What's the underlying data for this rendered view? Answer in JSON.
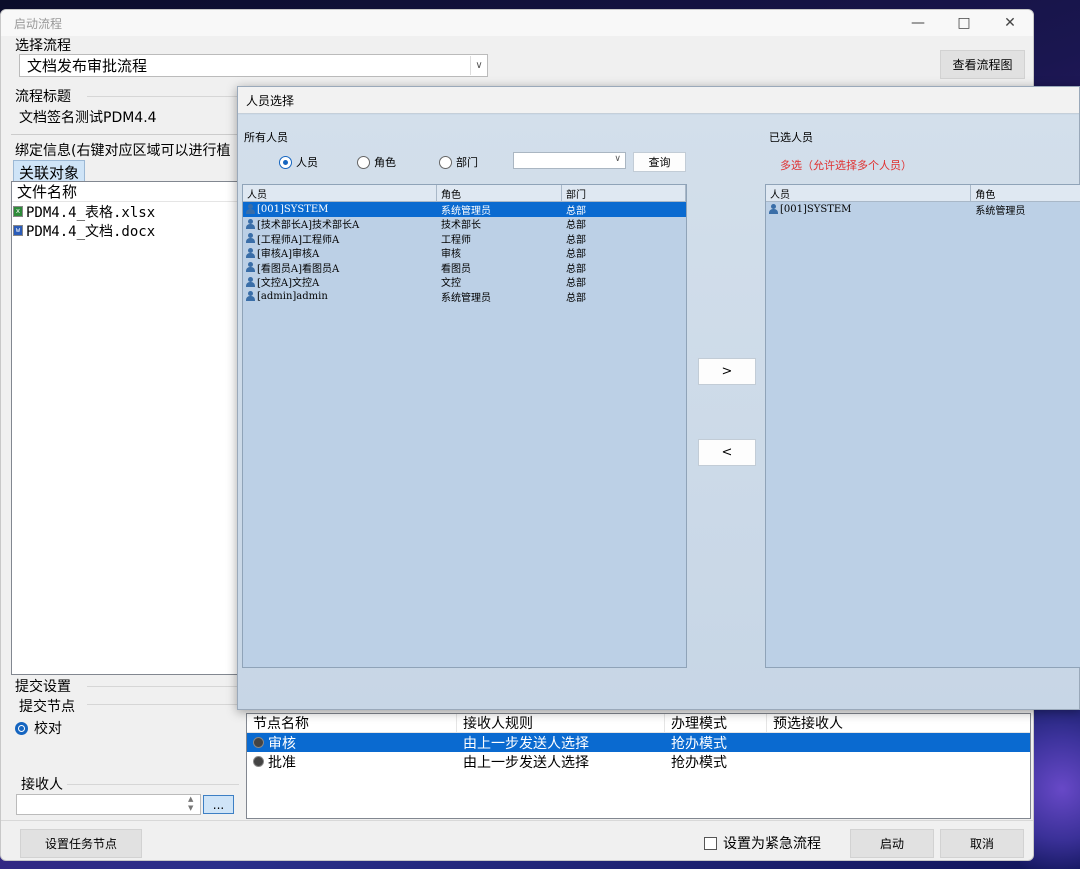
{
  "main": {
    "window_title": "启动流程",
    "select_flow_label": "选择流程",
    "flow_value": "文档发布审批流程",
    "view_flow_button": "查看流程图",
    "flow_title_label": "流程标题",
    "flow_title_value": "文档签名测试PDM4.4",
    "bind_info_label": "绑定信息(右键对应区域可以进行植",
    "tab_label": "关联对象",
    "file_header": "文件名称",
    "files": [
      "PDM4.4_表格.xlsx",
      "PDM4.4_文档.docx"
    ],
    "submit_settings_label": "提交设置",
    "submit_node_label": "提交节点",
    "node_radio_label": "校对",
    "receiver_label": "接收人",
    "receiver_value": "",
    "receiver_browse": "...",
    "nodes_headers": [
      "节点名称",
      "接收人规则",
      "办理模式",
      "预选接收人"
    ],
    "nodes_rows": [
      [
        "审核",
        "由上一步发送人选择",
        "抢办模式",
        ""
      ],
      [
        "批准",
        "由上一步发送人选择",
        "抢办模式",
        ""
      ]
    ],
    "set_task_node_button": "设置任务节点",
    "urgent_checkbox_label": "设置为紧急流程",
    "start_button": "启动",
    "cancel_button": "取消"
  },
  "dialog": {
    "title": "人员选择",
    "all_people_label": "所有人员",
    "filter_person": "人员",
    "filter_role": "角色",
    "filter_dept": "部门",
    "query_button": "查询",
    "selected_people_label": "已选人员",
    "multi_select_note": "多选（允许选择多个人员）",
    "left_headers": [
      "人员",
      "角色",
      "部门"
    ],
    "left_rows": [
      [
        "[001]SYSTEM",
        "系统管理员",
        "总部"
      ],
      [
        "[技术部长A]技术部长A",
        "技术部长",
        "总部"
      ],
      [
        "[工程师A]工程师A",
        "工程师",
        "总部"
      ],
      [
        "[审核A]审核A",
        "审核",
        "总部"
      ],
      [
        "[看图员A]看图员A",
        "看图员",
        "总部"
      ],
      [
        "[文控A]文控A",
        "文控",
        "总部"
      ],
      [
        "[admin]admin",
        "系统管理员",
        "总部"
      ]
    ],
    "right_headers": [
      "人员",
      "角色"
    ],
    "right_rows": [
      [
        "[001]SYSTEM",
        "系统管理员"
      ]
    ],
    "add_button": ">",
    "remove_button": "<"
  },
  "colors": {
    "selection": "#0a6ad0",
    "note_red": "#e03030",
    "dialog_bg": "#ccdae8"
  }
}
